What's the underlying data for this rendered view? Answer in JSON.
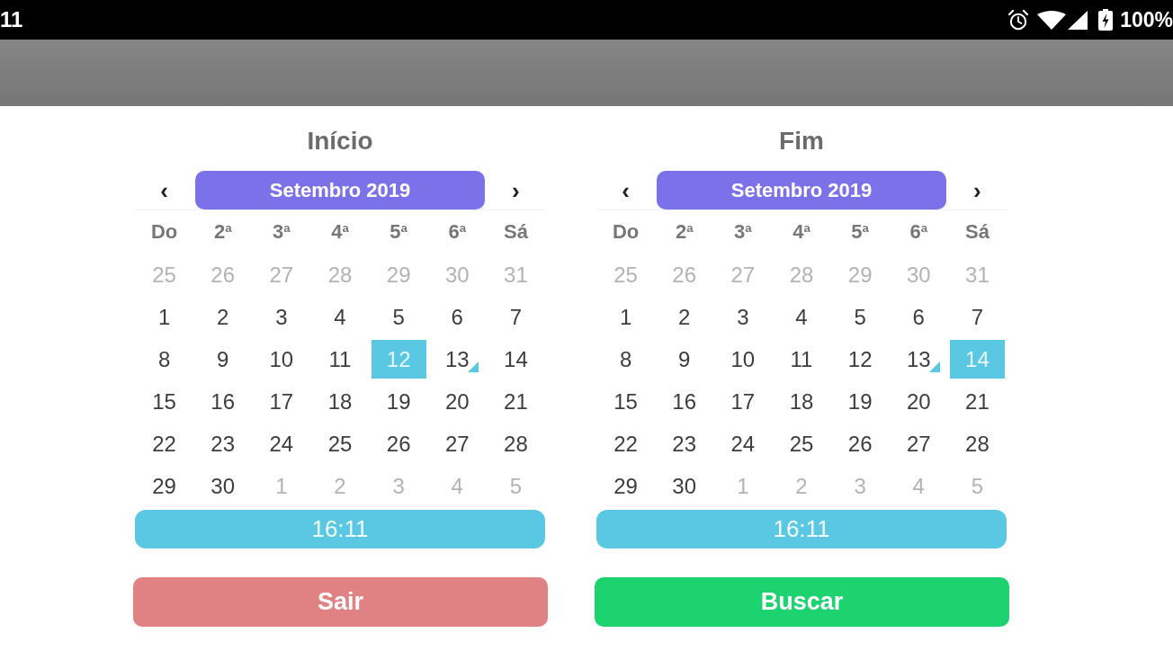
{
  "status_bar": {
    "time": "11",
    "battery": "100%"
  },
  "calendars": [
    {
      "title": "Início",
      "prev": "‹",
      "month": "Setembro 2019",
      "next": "›",
      "weekdays": [
        "Do",
        "2$^{a}$",
        "3$^{a}$",
        "4$^{a}$",
        "5$^{a}$",
        "6$^{a}$",
        "Sá"
      ],
      "weeks": [
        [
          {
            "day": "25",
            "outside": true,
            "selected": false,
            "today": false
          },
          {
            "day": "26",
            "outside": true,
            "selected": false,
            "today": false
          },
          {
            "day": "27",
            "outside": true,
            "selected": false,
            "today": false
          },
          {
            "day": "28",
            "outside": true,
            "selected": false,
            "today": false
          },
          {
            "day": "29",
            "outside": true,
            "selected": false,
            "today": false
          },
          {
            "day": "30",
            "outside": true,
            "selected": false,
            "today": false
          },
          {
            "day": "31",
            "outside": true,
            "selected": false,
            "today": false
          }
        ],
        [
          {
            "day": "1",
            "outside": false,
            "selected": false,
            "today": false
          },
          {
            "day": "2",
            "outside": false,
            "selected": false,
            "today": false
          },
          {
            "day": "3",
            "outside": false,
            "selected": false,
            "today": false
          },
          {
            "day": "4",
            "outside": false,
            "selected": false,
            "today": false
          },
          {
            "day": "5",
            "outside": false,
            "selected": false,
            "today": false
          },
          {
            "day": "6",
            "outside": false,
            "selected": false,
            "today": false
          },
          {
            "day": "7",
            "outside": false,
            "selected": false,
            "today": false
          }
        ],
        [
          {
            "day": "8",
            "outside": false,
            "selected": false,
            "today": false
          },
          {
            "day": "9",
            "outside": false,
            "selected": false,
            "today": false
          },
          {
            "day": "10",
            "outside": false,
            "selected": false,
            "today": false
          },
          {
            "day": "11",
            "outside": false,
            "selected": false,
            "today": false
          },
          {
            "day": "12",
            "outside": false,
            "selected": true,
            "today": false
          },
          {
            "day": "13",
            "outside": false,
            "selected": false,
            "today": true
          },
          {
            "day": "14",
            "outside": false,
            "selected": false,
            "today": false
          }
        ],
        [
          {
            "day": "15",
            "outside": false,
            "selected": false,
            "today": false
          },
          {
            "day": "16",
            "outside": false,
            "selected": false,
            "today": false
          },
          {
            "day": "17",
            "outside": false,
            "selected": false,
            "today": false
          },
          {
            "day": "18",
            "outside": false,
            "selected": false,
            "today": false
          },
          {
            "day": "19",
            "outside": false,
            "selected": false,
            "today": false
          },
          {
            "day": "20",
            "outside": false,
            "selected": false,
            "today": false
          },
          {
            "day": "21",
            "outside": false,
            "selected": false,
            "today": false
          }
        ],
        [
          {
            "day": "22",
            "outside": false,
            "selected": false,
            "today": false
          },
          {
            "day": "23",
            "outside": false,
            "selected": false,
            "today": false
          },
          {
            "day": "24",
            "outside": false,
            "selected": false,
            "today": false
          },
          {
            "day": "25",
            "outside": false,
            "selected": false,
            "today": false
          },
          {
            "day": "26",
            "outside": false,
            "selected": false,
            "today": false
          },
          {
            "day": "27",
            "outside": false,
            "selected": false,
            "today": false
          },
          {
            "day": "28",
            "outside": false,
            "selected": false,
            "today": false
          }
        ],
        [
          {
            "day": "29",
            "outside": false,
            "selected": false,
            "today": false
          },
          {
            "day": "30",
            "outside": false,
            "selected": false,
            "today": false
          },
          {
            "day": "1",
            "outside": true,
            "selected": false,
            "today": false
          },
          {
            "day": "2",
            "outside": true,
            "selected": false,
            "today": false
          },
          {
            "day": "3",
            "outside": true,
            "selected": false,
            "today": false
          },
          {
            "day": "4",
            "outside": true,
            "selected": false,
            "today": false
          },
          {
            "day": "5",
            "outside": true,
            "selected": false,
            "today": false
          }
        ]
      ],
      "time": "16:11"
    },
    {
      "title": "Fim",
      "prev": "‹",
      "month": "Setembro 2019",
      "next": "›",
      "weekdays": [
        "Do",
        "2$^{a}$",
        "3$^{a}$",
        "4$^{a}$",
        "5$^{a}$",
        "6$^{a}$",
        "Sá"
      ],
      "weeks": [
        [
          {
            "day": "25",
            "outside": true,
            "selected": false,
            "today": false
          },
          {
            "day": "26",
            "outside": true,
            "selected": false,
            "today": false
          },
          {
            "day": "27",
            "outside": true,
            "selected": false,
            "today": false
          },
          {
            "day": "28",
            "outside": true,
            "selected": false,
            "today": false
          },
          {
            "day": "29",
            "outside": true,
            "selected": false,
            "today": false
          },
          {
            "day": "30",
            "outside": true,
            "selected": false,
            "today": false
          },
          {
            "day": "31",
            "outside": true,
            "selected": false,
            "today": false
          }
        ],
        [
          {
            "day": "1",
            "outside": false,
            "selected": false,
            "today": false
          },
          {
            "day": "2",
            "outside": false,
            "selected": false,
            "today": false
          },
          {
            "day": "3",
            "outside": false,
            "selected": false,
            "today": false
          },
          {
            "day": "4",
            "outside": false,
            "selected": false,
            "today": false
          },
          {
            "day": "5",
            "outside": false,
            "selected": false,
            "today": false
          },
          {
            "day": "6",
            "outside": false,
            "selected": false,
            "today": false
          },
          {
            "day": "7",
            "outside": false,
            "selected": false,
            "today": false
          }
        ],
        [
          {
            "day": "8",
            "outside": false,
            "selected": false,
            "today": false
          },
          {
            "day": "9",
            "outside": false,
            "selected": false,
            "today": false
          },
          {
            "day": "10",
            "outside": false,
            "selected": false,
            "today": false
          },
          {
            "day": "11",
            "outside": false,
            "selected": false,
            "today": false
          },
          {
            "day": "12",
            "outside": false,
            "selected": false,
            "today": false
          },
          {
            "day": "13",
            "outside": false,
            "selected": false,
            "today": true
          },
          {
            "day": "14",
            "outside": false,
            "selected": true,
            "today": false
          }
        ],
        [
          {
            "day": "15",
            "outside": false,
            "selected": false,
            "today": false
          },
          {
            "day": "16",
            "outside": false,
            "selected": false,
            "today": false
          },
          {
            "day": "17",
            "outside": false,
            "selected": false,
            "today": false
          },
          {
            "day": "18",
            "outside": false,
            "selected": false,
            "today": false
          },
          {
            "day": "19",
            "outside": false,
            "selected": false,
            "today": false
          },
          {
            "day": "20",
            "outside": false,
            "selected": false,
            "today": false
          },
          {
            "day": "21",
            "outside": false,
            "selected": false,
            "today": false
          }
        ],
        [
          {
            "day": "22",
            "outside": false,
            "selected": false,
            "today": false
          },
          {
            "day": "23",
            "outside": false,
            "selected": false,
            "today": false
          },
          {
            "day": "24",
            "outside": false,
            "selected": false,
            "today": false
          },
          {
            "day": "25",
            "outside": false,
            "selected": false,
            "today": false
          },
          {
            "day": "26",
            "outside": false,
            "selected": false,
            "today": false
          },
          {
            "day": "27",
            "outside": false,
            "selected": false,
            "today": false
          },
          {
            "day": "28",
            "outside": false,
            "selected": false,
            "today": false
          }
        ],
        [
          {
            "day": "29",
            "outside": false,
            "selected": false,
            "today": false
          },
          {
            "day": "30",
            "outside": false,
            "selected": false,
            "today": false
          },
          {
            "day": "1",
            "outside": true,
            "selected": false,
            "today": false
          },
          {
            "day": "2",
            "outside": true,
            "selected": false,
            "today": false
          },
          {
            "day": "3",
            "outside": true,
            "selected": false,
            "today": false
          },
          {
            "day": "4",
            "outside": true,
            "selected": false,
            "today": false
          },
          {
            "day": "5",
            "outside": true,
            "selected": false,
            "today": false
          }
        ]
      ],
      "time": "16:11"
    }
  ],
  "buttons": [
    {
      "label": "Sair",
      "color": "#e08283"
    },
    {
      "label": "Buscar",
      "color": "#1dd36f"
    }
  ]
}
